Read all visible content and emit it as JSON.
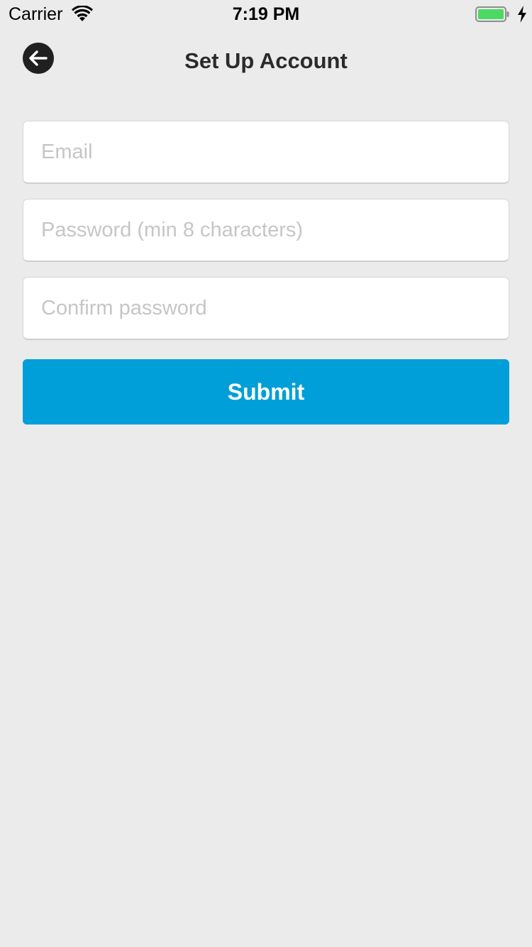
{
  "status_bar": {
    "carrier": "Carrier",
    "time": "7:19 PM",
    "icons": [
      "wifi-icon",
      "battery-icon",
      "charging-bolt-icon"
    ],
    "battery_color": "#4cd964"
  },
  "header": {
    "title": "Set Up Account",
    "back_icon": "arrow-left-icon"
  },
  "form": {
    "email": {
      "value": "",
      "placeholder": "Email"
    },
    "password": {
      "value": "",
      "placeholder": "Password (min 8 characters)"
    },
    "confirm_password": {
      "value": "",
      "placeholder": "Confirm password"
    },
    "submit_label": "Submit"
  },
  "colors": {
    "background": "#ebebeb",
    "accent": "#009fd9",
    "back_button": "#202020"
  }
}
